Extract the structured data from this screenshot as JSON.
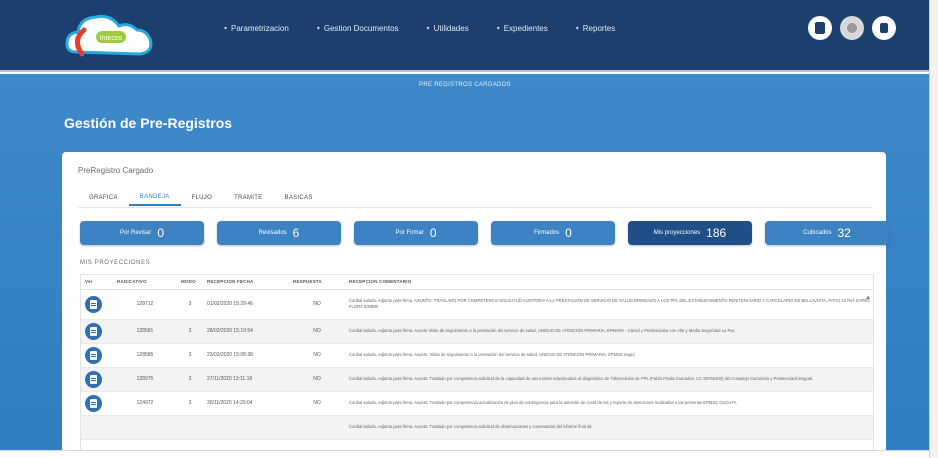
{
  "nav": {
    "logo_text": "Intecos",
    "menu": [
      {
        "label": "Parametrizacion",
        "icon": "chevron-down-icon"
      },
      {
        "label": "Gestion Documentos",
        "icon": "chevron-down-icon"
      },
      {
        "label": "Utilidades",
        "icon": "chevron-down-icon"
      },
      {
        "label": "Expedientes",
        "icon": "chevron-down-icon"
      },
      {
        "label": "Reportes",
        "icon": "chevron-down-icon"
      }
    ],
    "icons": [
      "document-icon",
      "user-avatar-icon",
      "logout-icon"
    ]
  },
  "header": {
    "subtitle": "PRE REGISTROS CARGADOS",
    "title": "Gestión de Pre-Registros"
  },
  "card": {
    "title": "PreRegistro Cargado",
    "tabs": [
      {
        "label": "GRAFICA",
        "active": false
      },
      {
        "label": "BANDEJA",
        "active": true
      },
      {
        "label": "FLUJO",
        "active": false
      },
      {
        "label": "TRAMITE",
        "active": false
      },
      {
        "label": "BASICAS",
        "active": false
      }
    ],
    "stats": [
      {
        "label": "Por Revisar",
        "value": "0"
      },
      {
        "label": "Revisados",
        "value": "6"
      },
      {
        "label": "Por Firmar",
        "value": "0"
      },
      {
        "label": "Firmados",
        "value": "0"
      },
      {
        "label": "Mis proyecciones",
        "value": "186"
      },
      {
        "label": "Cubicados",
        "value": "32"
      }
    ],
    "section_label": "MIS PROYECCIONES",
    "table": {
      "columns": [
        "Ver",
        "RADICATIVO",
        "MODO",
        "RECEPCION FECHA",
        "RESPUESTA",
        "RECEPCION COMENTARIO"
      ],
      "rows": [
        {
          "radicado": "128712",
          "modo": "3",
          "fecha": "01/02/2020 15:29:46",
          "respuesta": "NO",
          "comentario": "Cordial saludo, Adjunto para firma. ASUNTO: TRASLADO POR COMPETENCIA SOLICITUD AUDITORIA A LA PRESTACION DE SERVICIO DE SALUD BRINDADO A LOS PPL DEL ESTABLECIMIENTO PENITENCIARIO Y CARCELARIO DE BELLAVISTA, PATIO 10 Ref: EXPEC FLORA 000888"
        },
        {
          "radicado": "128581",
          "modo": "3",
          "fecha": "28/02/2020 15:19:54",
          "respuesta": "NO",
          "comentario": "Cordial saludo, Adjunto para firma. Asunto Visita de seguimiento a la prestación del servicio de salud, UNIDAD DE ATENCIÓN PRIMARIA, EPMSPA - Cárcel y Penitenciaria con Alta y Media Seguridad La Paz"
        },
        {
          "radicado": "128585",
          "modo": "3",
          "fecha": "23/03/2020 15:08:38",
          "respuesta": "NO",
          "comentario": "Cordial saludo, Adjunto para firma. Asunto: Visita de seguimiento a la prestación del servicio de salud, UNIDAD DE ATENCIÓN PRIMARIA, EPMSC Itagüí"
        },
        {
          "radicado": "128975",
          "modo": "3",
          "fecha": "27/11/2020 13:11:18",
          "respuesta": "NO",
          "comentario": "Cordial saludo, Adjunto para firma. Asunto: Traslado por competencia solicitud de la capacidad de atenciones relacionadas al diagnóstico de Tuberculosis de PPL (Pablo Prada Granados, CC 80765400) del Complejo Carcelario y Penitenciario Bogotá"
        },
        {
          "radicado": "124972",
          "modo": "3",
          "fecha": "30/11/2020 14:20:04",
          "respuesta": "NO",
          "comentario": "Cordial saludo, Adjunto para firma. Asunto: Traslado por competencia actualización de plan de contingencia para la atención de covid de los y reporte de atenciones realizadas a las personas EPMSC CUCUTA"
        },
        {
          "radicado": "",
          "modo": "",
          "fecha": "",
          "respuesta": "",
          "comentario": "Cordial saludo, Adjunto para firma. Asunto: Traslado por competencia solicitud de observaciones y comentarios del informe final de"
        }
      ]
    }
  },
  "colors": {
    "nav_bg": "#1d3f6e",
    "hero_bg": "#3e89c9",
    "stat_bg": "#3d82c3",
    "stat_active_bg": "#1f4f86",
    "accent": "#2f7ec1"
  }
}
